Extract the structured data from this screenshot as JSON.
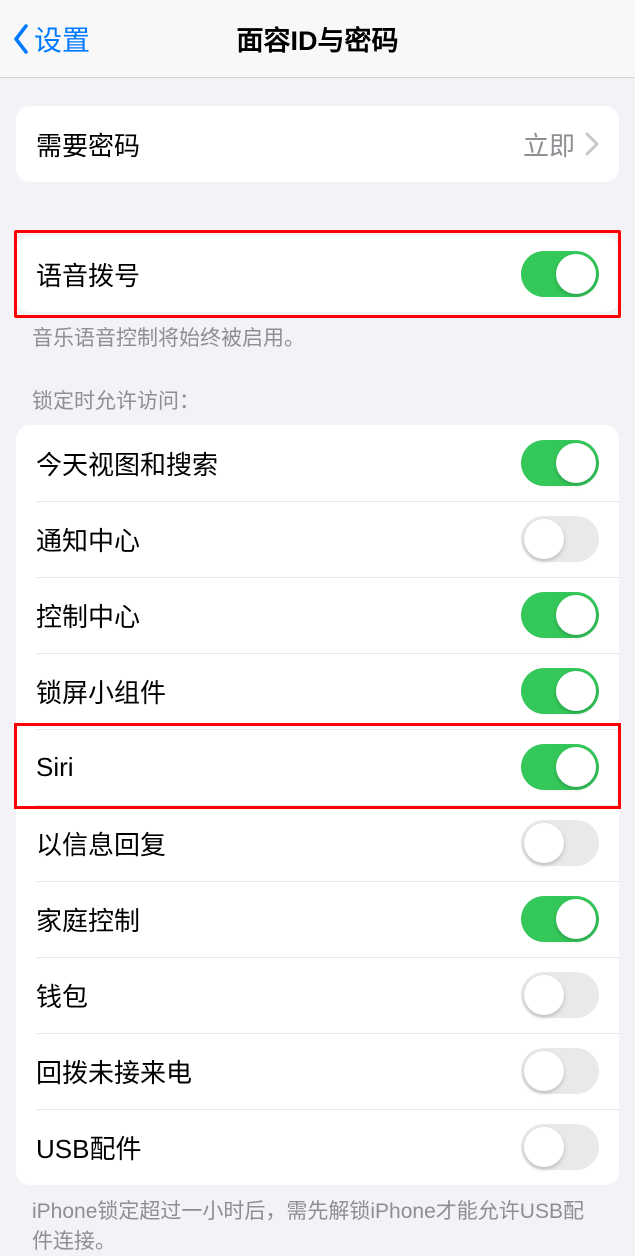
{
  "nav": {
    "back_label": "设置",
    "title": "面容ID与密码"
  },
  "passcode_group": {
    "require_passcode_label": "需要密码",
    "require_passcode_value": "立即"
  },
  "voice_dial": {
    "label": "语音拨号",
    "on": true,
    "footer": "音乐语音控制将始终被启用。"
  },
  "locked_access": {
    "header": "锁定时允许访问：",
    "items": [
      {
        "label": "今天视图和搜索",
        "on": true
      },
      {
        "label": "通知中心",
        "on": false
      },
      {
        "label": "控制中心",
        "on": true
      },
      {
        "label": "锁屏小组件",
        "on": true
      },
      {
        "label": "Siri",
        "on": true
      },
      {
        "label": "以信息回复",
        "on": false
      },
      {
        "label": "家庭控制",
        "on": true
      },
      {
        "label": "钱包",
        "on": false
      },
      {
        "label": "回拨未接来电",
        "on": false
      },
      {
        "label": "USB配件",
        "on": false
      }
    ],
    "footer": "iPhone锁定超过一小时后，需先解锁iPhone才能允许USB配件连接。"
  }
}
